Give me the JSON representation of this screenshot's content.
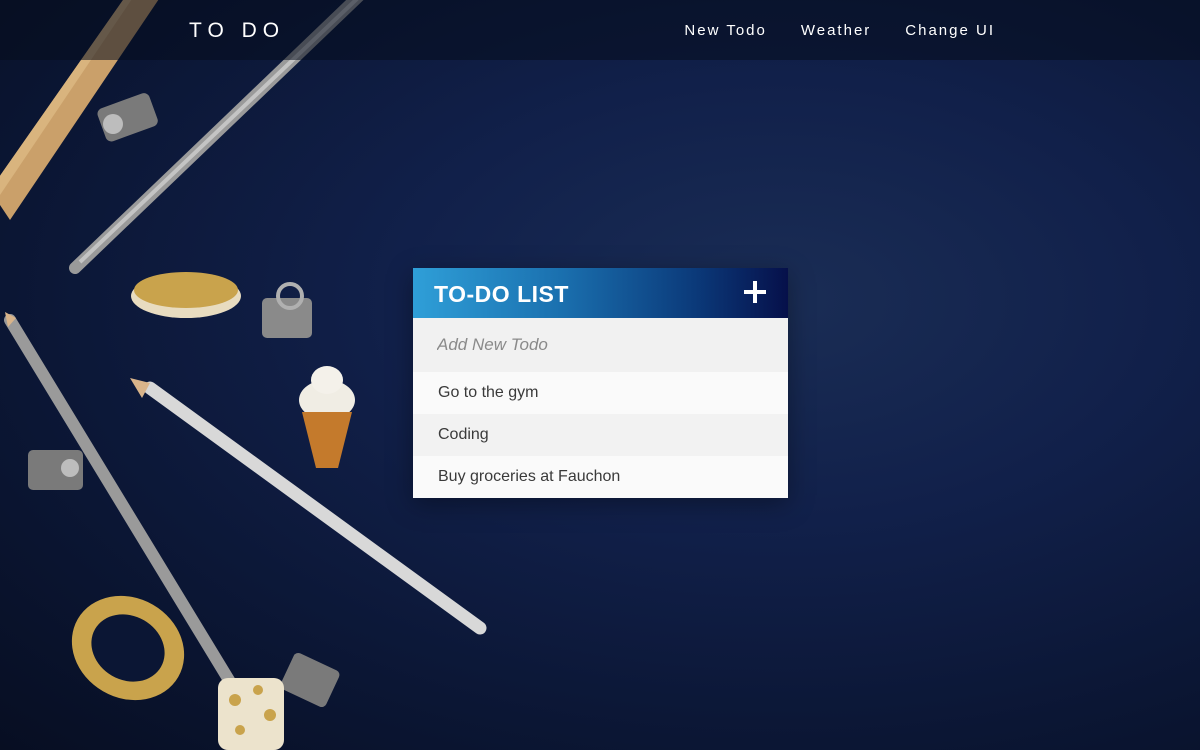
{
  "app": {
    "brand": "TO DO"
  },
  "nav": {
    "items": [
      {
        "label": "New Todo"
      },
      {
        "label": "Weather"
      },
      {
        "label": "Change UI"
      }
    ]
  },
  "todo": {
    "title": "TO-DO LIST",
    "add_icon": "plus-icon",
    "input_placeholder": "Add New Todo",
    "items": [
      {
        "text": "Go to the gym"
      },
      {
        "text": "Coding"
      },
      {
        "text": "Buy groceries at Fauchon"
      }
    ]
  },
  "colors": {
    "header_gradient_start": "#2f9fd8",
    "header_gradient_end": "#06104a",
    "background": "#11204a"
  }
}
